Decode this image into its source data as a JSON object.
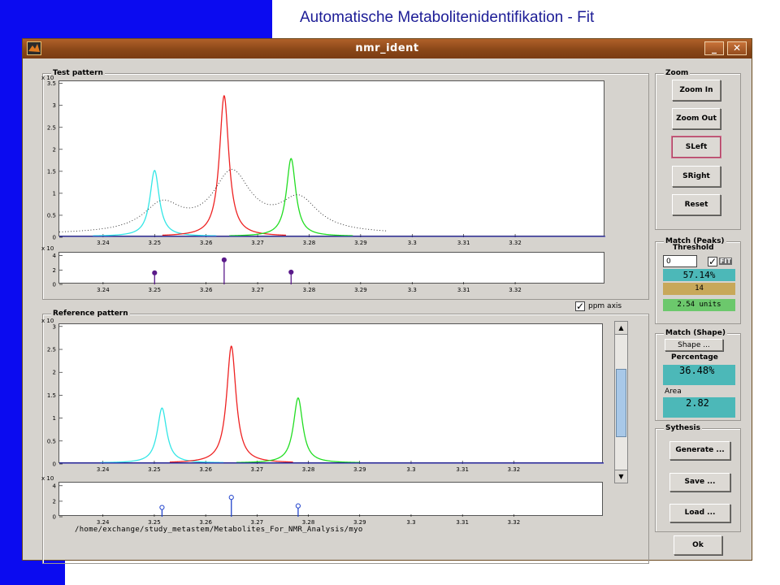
{
  "slide": {
    "title": "Automatische Metabolitenidentifikation - Fit"
  },
  "window": {
    "title": "nmr_ident",
    "minimize_label": "_",
    "close_label": "✕",
    "icon": "matlab-icon"
  },
  "test_panel": {
    "title": "Test pattern",
    "spectrum": {
      "x_ticks": [
        "3.24",
        "3.25",
        "3.26",
        "3.27",
        "3.28",
        "3.29",
        "3.3",
        "3.31",
        "3.32"
      ],
      "y_ticks": [
        "0",
        "0.5",
        "1",
        "1.5",
        "2",
        "2.5",
        "3",
        "3.5"
      ],
      "exponent": "x 10",
      "peaks": [
        {
          "center": 3.25,
          "height": 1.5,
          "color": "#33e6e6"
        },
        {
          "center": 3.2635,
          "height": 3.2,
          "color": "#ee2222"
        },
        {
          "center": 3.2765,
          "height": 1.77,
          "color": "#22dd22"
        }
      ]
    },
    "stems": {
      "exponent": "x 10",
      "y_ticks": [
        "0",
        "2",
        "4"
      ],
      "x_ticks": [
        "3.24",
        "3.25",
        "3.26",
        "3.27",
        "3.28",
        "3.29",
        "3.3",
        "3.31",
        "3.32"
      ],
      "points": [
        {
          "x": 3.25,
          "y": 1.6
        },
        {
          "x": 3.2635,
          "y": 3.4
        },
        {
          "x": 3.2765,
          "y": 1.7
        }
      ]
    }
  },
  "ppm_axis": {
    "label": "ppm axis",
    "checked": true
  },
  "reference_panel": {
    "title": "Reference pattern",
    "spectrum": {
      "x_ticks": [
        "3.24",
        "3.25",
        "3.26",
        "3.27",
        "3.28",
        "3.29",
        "3.3",
        "3.31",
        "3.32"
      ],
      "y_ticks": [
        "0",
        "0.5",
        "1",
        "1.5",
        "2",
        "2.5",
        "3"
      ],
      "exponent": "x 10",
      "peaks": [
        {
          "center": 3.2515,
          "height": 1.2,
          "color": "#33e6e6"
        },
        {
          "center": 3.265,
          "height": 2.55,
          "color": "#ee2222"
        },
        {
          "center": 3.278,
          "height": 1.42,
          "color": "#22dd22"
        }
      ]
    },
    "stems": {
      "exponent": "x 10",
      "y_ticks": [
        "0",
        "2",
        "4"
      ],
      "x_ticks": [
        "3.24",
        "3.25",
        "3.26",
        "3.27",
        "3.28",
        "3.29",
        "3.3",
        "3.31",
        "3.32"
      ],
      "points": [
        {
          "x": 3.2515,
          "y": 1.2
        },
        {
          "x": 3.265,
          "y": 2.5
        },
        {
          "x": 3.278,
          "y": 1.4
        }
      ]
    },
    "path": "/home/exchange/study_metastem/Metabolites_For_NMR_Analysis/myo"
  },
  "zoom": {
    "title": "Zoom",
    "zoom_in": "Zoom In",
    "zoom_out": "Zoom Out",
    "sleft": "SLeft",
    "sright": "SRight",
    "reset": "Reset"
  },
  "match_peaks": {
    "title": "Match (Peaks)",
    "threshold_label": "Threshold",
    "threshold_value": "0",
    "fit_label": "FIT",
    "fit_checked": true,
    "percentage": "57.14%",
    "count": "14",
    "units": "2.54 units",
    "colors": {
      "percentage": "#4cb8b8",
      "count": "#c8a85a",
      "units": "#6cc86c"
    }
  },
  "match_shape": {
    "title": "Match (Shape)",
    "shape_button": "Shape ...",
    "percentage_label": "Percentage",
    "percentage_value": "36.48%",
    "area_label": "Area",
    "area_value": "2.82",
    "colors": {
      "value_bg": "#4cb8b8"
    }
  },
  "synthesis": {
    "title": "Sythesis",
    "generate": "Generate ...",
    "save": "Save ...",
    "load": "Load ..."
  },
  "ok_button": "Ok"
}
